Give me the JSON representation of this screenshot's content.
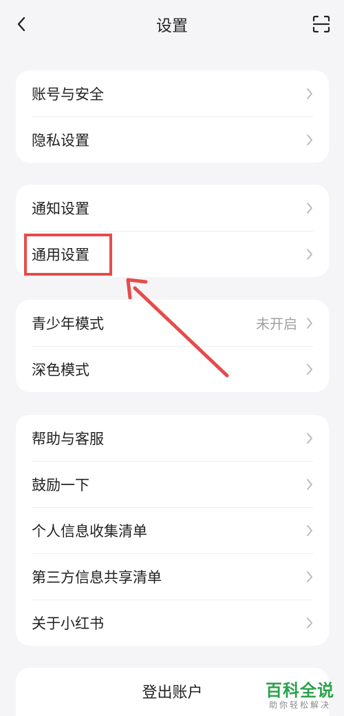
{
  "header": {
    "title": "设置",
    "back_icon": "chevron-left-icon",
    "scan_icon": "scan-icon"
  },
  "groups": [
    {
      "items": [
        {
          "label": "账号与安全"
        },
        {
          "label": "隐私设置"
        }
      ]
    },
    {
      "items": [
        {
          "label": "通知设置"
        },
        {
          "label": "通用设置"
        }
      ]
    },
    {
      "items": [
        {
          "label": "青少年模式",
          "status": "未开启"
        },
        {
          "label": "深色模式"
        }
      ]
    },
    {
      "items": [
        {
          "label": "帮助与客服"
        },
        {
          "label": "鼓励一下"
        },
        {
          "label": "个人信息收集清单"
        },
        {
          "label": "第三方信息共享清单"
        },
        {
          "label": "关于小红书"
        }
      ]
    }
  ],
  "logout": {
    "label": "登出账户"
  },
  "annotation": {
    "color": "#e64b4b",
    "target": "通用设置"
  },
  "watermark": {
    "main": "百科全说",
    "sub": "助你轻松解决"
  }
}
